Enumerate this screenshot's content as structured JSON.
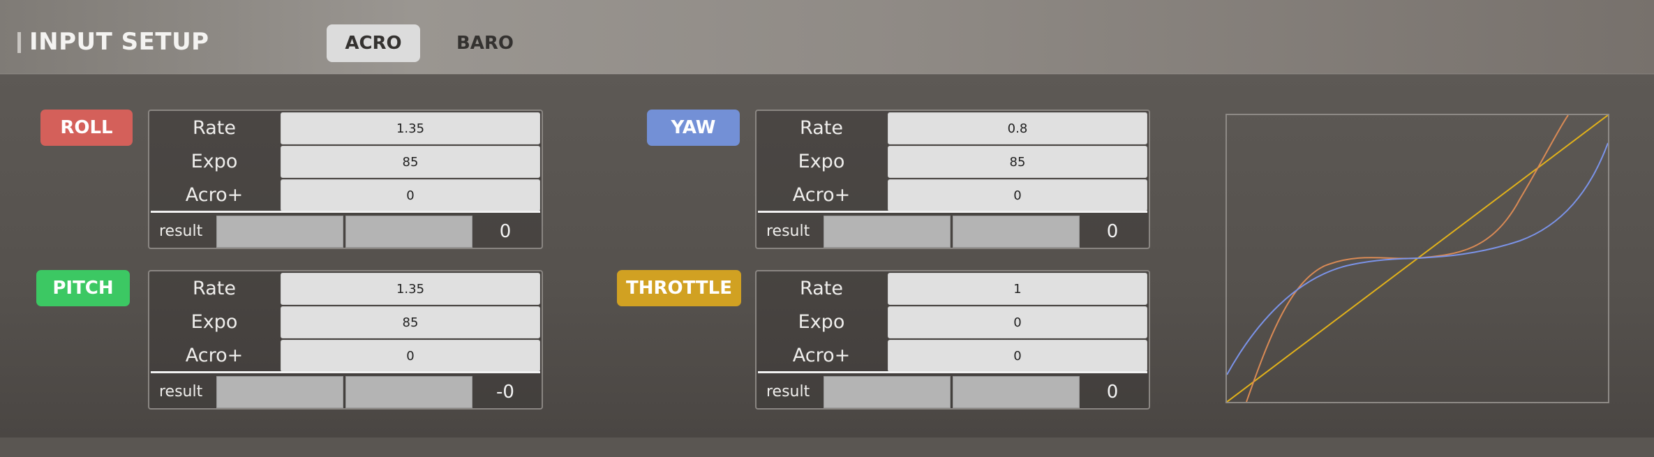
{
  "header": {
    "title": "INPUT SETUP",
    "tabs": [
      {
        "label": "ACRO",
        "active": true
      },
      {
        "label": "BARO",
        "active": false
      }
    ]
  },
  "row_labels": {
    "rate": "Rate",
    "expo": "Expo",
    "acro": "Acro+",
    "result": "result"
  },
  "axes": {
    "roll": {
      "label": "ROLL",
      "color": "#d4605a",
      "rate": "1.35",
      "expo": "85",
      "acro": "0",
      "result": "0"
    },
    "pitch": {
      "label": "PITCH",
      "color": "#3cc863",
      "rate": "1.35",
      "expo": "85",
      "acro": "0",
      "result": "-0"
    },
    "yaw": {
      "label": "YAW",
      "color": "#7390d6",
      "rate": "0.8",
      "expo": "85",
      "acro": "0",
      "result": "0"
    },
    "throttle": {
      "label": "THROTTLE",
      "color": "#d1a122",
      "rate": "1",
      "expo": "0",
      "acro": "0",
      "result": "0"
    }
  },
  "curve_graph": {
    "series_colors": {
      "blue": "#7b93e8",
      "orange": "#d98a55",
      "yellow": "#e2b21a"
    }
  }
}
